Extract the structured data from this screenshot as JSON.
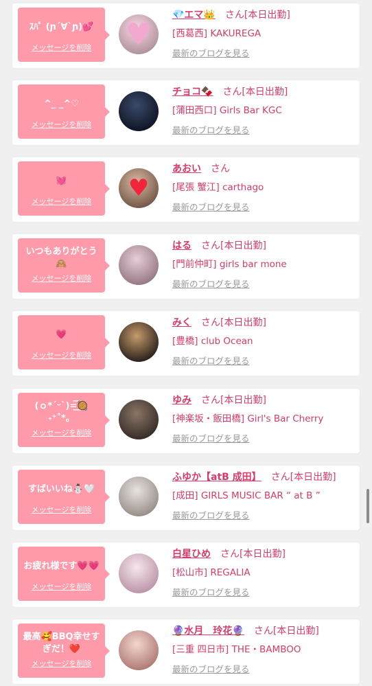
{
  "colors": {
    "accent": "#d93a6a",
    "bubble": "#ff9aaa",
    "muted": "#999999",
    "background": "#f0f0f0"
  },
  "messages": [
    {
      "message": "ｽﾊﾟ (ɲ´∀`ɲ)💕",
      "delete_label": "メッセージを削除",
      "name": "💎エマ👑",
      "suffix": "さん[本日出勤]",
      "shop": "[西葛西] KAKUREGA",
      "blog": "最新のブログを見る",
      "avatar_icon": "pink-heart-icon",
      "avatar_colors": [
        "#f7d6e6",
        "#a98c92"
      ]
    },
    {
      "message": "^_ _^♡",
      "delete_label": "メッセージを削除",
      "name": "チョコ🍫",
      "suffix": "さん[本日出勤]",
      "shop": "[蒲田西口] Girls Bar KGC",
      "blog": "最新のブログを見る",
      "avatar_icon": "night-city-photo",
      "avatar_colors": [
        "#3a4a6a",
        "#0b0f1c"
      ]
    },
    {
      "message": "💓",
      "delete_label": "メッセージを削除",
      "name": "あおい",
      "suffix": "さん",
      "shop": "[尾張 蟹江] carthago",
      "blog": "最新のブログを見る",
      "avatar_icon": "red-heart-icon",
      "avatar_colors": [
        "#d9b9a3",
        "#6a4d3f"
      ]
    },
    {
      "message": "いつもありがとう🙈",
      "delete_label": "メッセージを削除",
      "name": "はる",
      "suffix": "さん[本日出勤]",
      "shop": "[門前仲町] girls bar mone",
      "blog": "最新のブログを見る",
      "avatar_icon": "blurred-photo",
      "avatar_colors": [
        "#e6cdd7",
        "#8e6f7d"
      ]
    },
    {
      "message": "💗",
      "delete_label": "メッセージを削除",
      "name": "みく",
      "suffix": "さん[本日出勤]",
      "shop": "[豊橋] club Ocean",
      "blog": "最新のブログを見る",
      "avatar_icon": "portrait-photo",
      "avatar_colors": [
        "#c49a6a",
        "#1a1414"
      ]
    },
    {
      "message": "(ｏ*ˊᵕˋ)=͟͟͞͞🥘 ˖⁺˚*。",
      "delete_label": "メッセージを削除",
      "name": "ゆみ",
      "suffix": "さん[本日出勤]",
      "shop": "[神楽坂・飯田橋] Girl's Bar Cherry",
      "blog": "最新のブログを見る",
      "avatar_icon": "portrait-photo",
      "avatar_colors": [
        "#8a7666",
        "#2d2420"
      ]
    },
    {
      "message": "すばいいね⛄🤍",
      "delete_label": "メッセージを削除",
      "name": "ふゆか【atB 成田】",
      "suffix": "さん[本日出勤]",
      "shop": "[成田] GIRLS MUSIC BAR “ at B ”",
      "blog": "最新のブログを見る",
      "avatar_icon": "portrait-photo",
      "avatar_colors": [
        "#e8e3e0",
        "#8f8580"
      ]
    },
    {
      "message": "お疲れ様です💗💗",
      "delete_label": "メッセージを削除",
      "name": "白星ひめ",
      "suffix": "さん[本日出勤]",
      "shop": "[松山市] REGALIA",
      "blog": "最新のブログを見る",
      "avatar_icon": "regalia-photo",
      "avatar_colors": [
        "#f6e6ee",
        "#b58ca0"
      ]
    },
    {
      "message": "最高🥰BBQ幸せすぎだ！❤️",
      "delete_label": "メッセージを削除",
      "name": "🔮水月　玲花🔮",
      "suffix": "さん[本日出勤]",
      "shop": "[三重 四日市] THE・BAMBOO",
      "blog": "最新のブログを見る",
      "avatar_icon": "portrait-photo",
      "avatar_colors": [
        "#f3d6d0",
        "#a8706a"
      ]
    }
  ]
}
